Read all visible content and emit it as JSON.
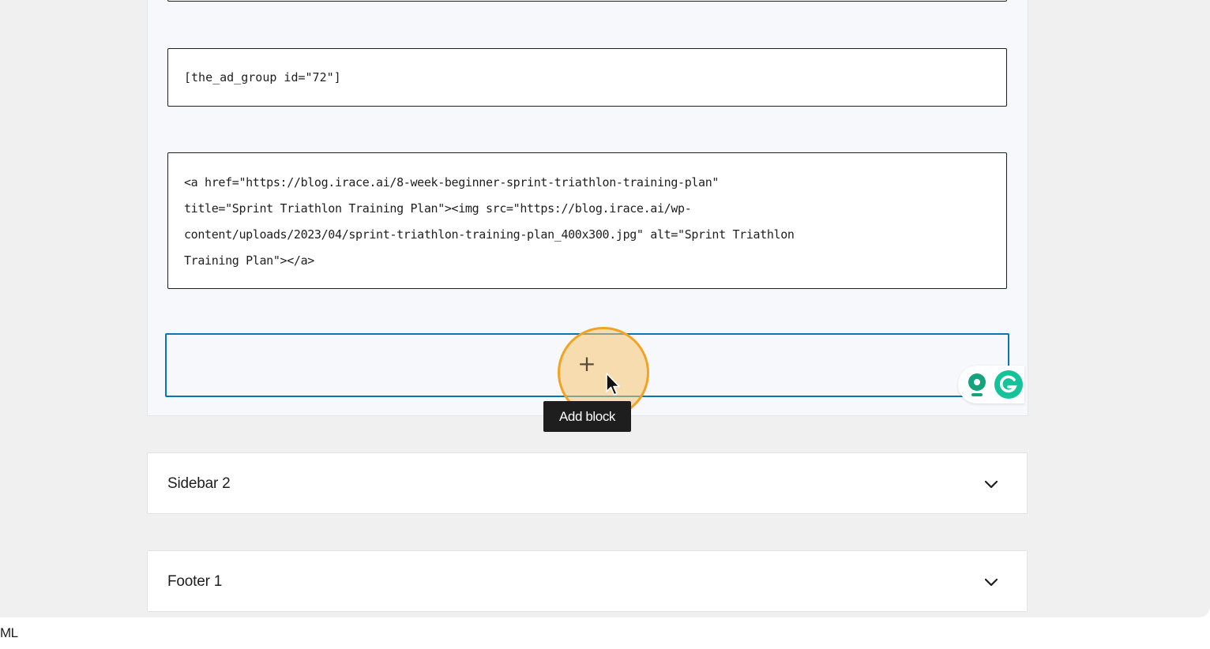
{
  "shortcode_block": {
    "content": "[the_ad_group id=\"72\"]"
  },
  "html_block": {
    "content": "<a href=\"https://blog.irace.ai/8-week-beginner-sprint-triathlon-training-plan\"\ntitle=\"Sprint Triathlon Training Plan\"><img src=\"https://blog.irace.ai/wp-\ncontent/uploads/2023/04/sprint-triathlon-training-plan_400x300.jpg\" alt=\"Sprint Triathlon\nTraining Plan\"></a>"
  },
  "appender": {
    "icon": "plus-icon",
    "tooltip": "Add block"
  },
  "extensions": {
    "icons": [
      "lightbulb-extension-icon",
      "grammarly-icon"
    ],
    "grammarly_color": "#15c39a"
  },
  "widget_areas": [
    {
      "title": "Sidebar 2",
      "icon": "chevron-down-icon"
    },
    {
      "title": "Footer 1",
      "icon": "chevron-down-icon"
    }
  ],
  "status_bar": {
    "text": "ML"
  },
  "colors": {
    "accent": "#0a75b5",
    "highlight": "#f2a323",
    "tooltip_bg": "#1e1e1e"
  }
}
